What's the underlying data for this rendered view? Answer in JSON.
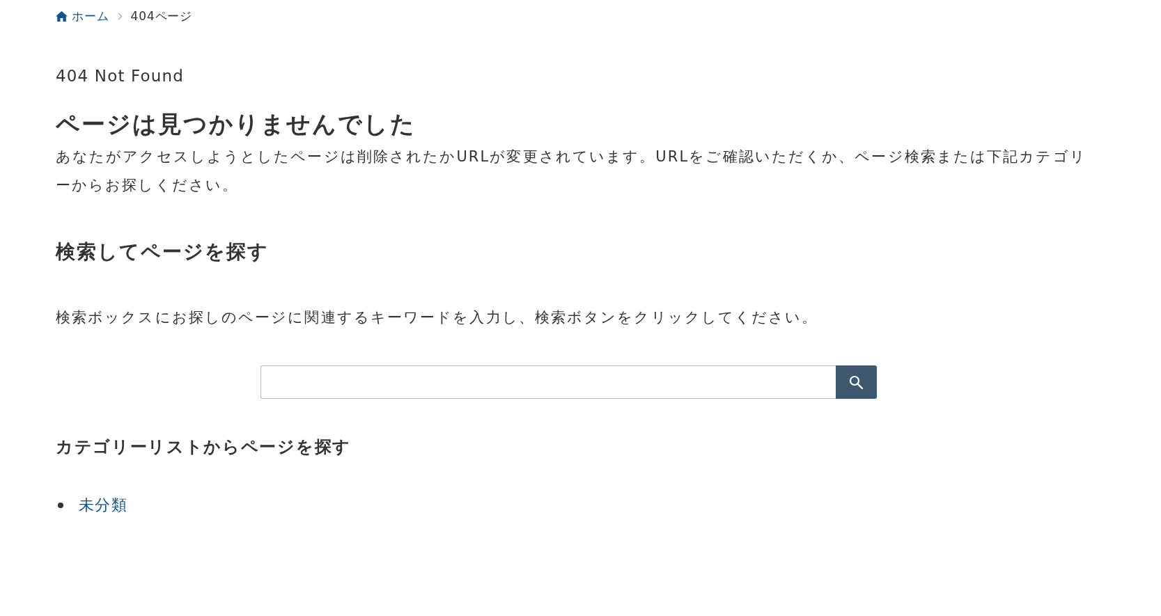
{
  "breadcrumb": [
    {
      "label": "ホーム",
      "kind": "home"
    },
    {
      "label": "404ページ",
      "kind": "current"
    }
  ],
  "page_label": "404 Not Found",
  "title": "ページは見つかりませんでした",
  "message": "あなたがアクセスしようとしたページは削除されたかURLが変更されています。URLをご確認いただくか、ページ検索または下記カテゴリーからお探しください。",
  "search_section": {
    "heading": "検索してページを探す",
    "description": "検索ボックスにお探しのページに関連するキーワードを入力し、検索ボタンをクリックしてください。"
  },
  "category_section": {
    "heading": "カテゴリーリストからページを探す",
    "categories": [
      {
        "label": "未分類"
      }
    ]
  }
}
